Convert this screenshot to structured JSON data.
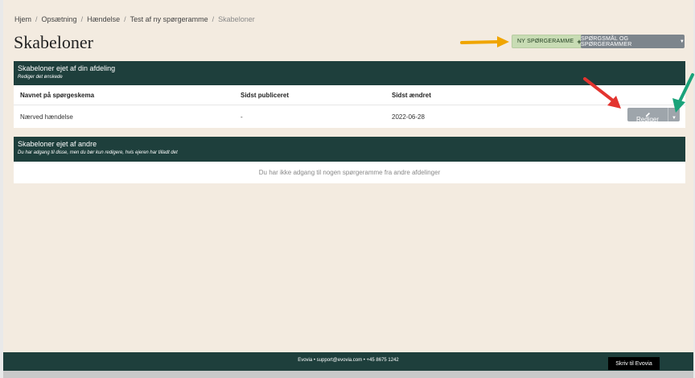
{
  "breadcrumb": {
    "items": [
      "Hjem",
      "Opsætning",
      "Hændelse",
      "Test af ny spørgeramme"
    ],
    "current": "Skabeloner",
    "separator": "/"
  },
  "page": {
    "title": "Skabeloner"
  },
  "toolbar": {
    "new_label": "NY SPØRGERAMME",
    "new_icon": "plus-icon",
    "questions_label": "SPØRGSMÅL OG SPØRGERAMMER",
    "questions_icon": "caret-down-icon"
  },
  "own_templates": {
    "title": "Skabeloner ejet af din afdeling",
    "subtitle": "Rediger det ønskede",
    "columns": [
      "Navnet på spørgeskema",
      "Sidst publiceret",
      "Sidst ændret"
    ],
    "rows": [
      {
        "name": "Nærved hændelse",
        "published": "-",
        "changed": "2022-06-28"
      }
    ],
    "edit_label": "Rediger",
    "edit_icon": "pencil-icon"
  },
  "others_templates": {
    "title": "Skabeloner ejet af andre",
    "subtitle": "Du har adgang til disse, men du bør kun redigere, hvis ejeren har tilladt det",
    "empty_message": "Du har ikke adgang til nogen spørgeramme fra andre afdelinger"
  },
  "footer": {
    "text": "Evovia • support@evovia.com • +45 8675 1242",
    "write_label": "Skriv til Evovia"
  },
  "colors": {
    "background": "#f3ebe0",
    "panel_header": "#1e3f3c",
    "new_button": "#c8dcb4",
    "secondary_button": "#7d858c",
    "annotation_orange": "#f0a500",
    "annotation_red": "#e3342f",
    "annotation_green": "#1aa37a"
  },
  "annotations": [
    "orange-arrow-icon",
    "red-arrow-icon",
    "green-arrow-icon"
  ]
}
